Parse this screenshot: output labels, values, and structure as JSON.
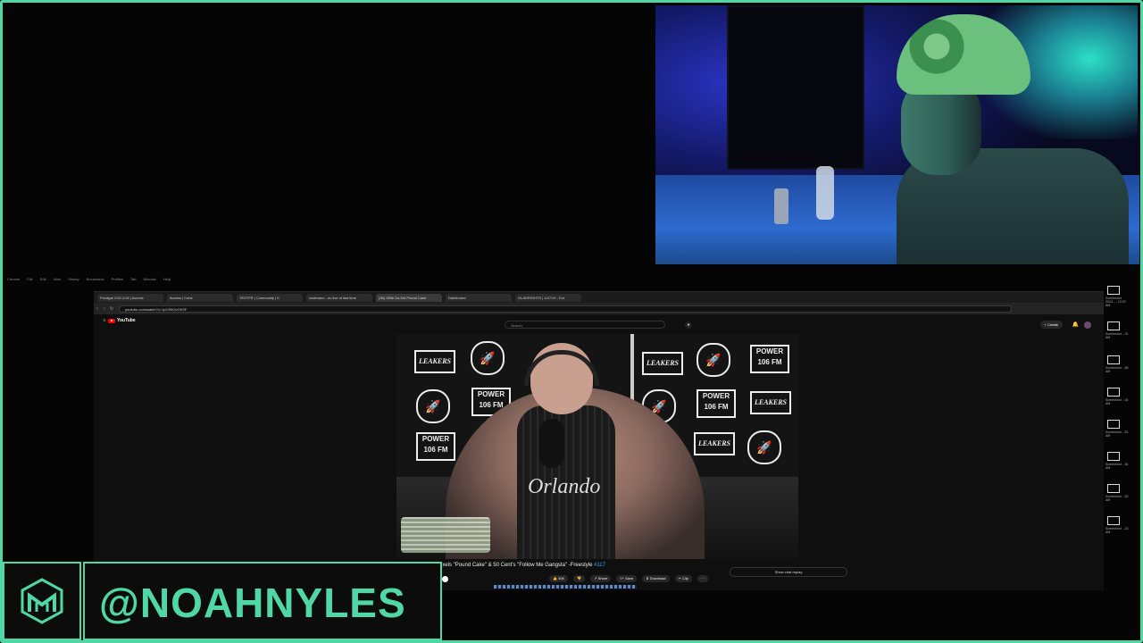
{
  "os_menu": [
    "Chrome",
    "File",
    "Edit",
    "View",
    "History",
    "Bookmarks",
    "Profiles",
    "Tab",
    "Window",
    "Help"
  ],
  "browser": {
    "tabs": [
      {
        "label": "Prodigal 1/10-1/16 | Access"
      },
      {
        "label": "Access | Cohe"
      },
      {
        "label": "TEXTFR | Community | K"
      },
      {
        "label": "codenano - av live of last time"
      },
      {
        "label": "(36) Gillie Da Kid Pound Cake"
      },
      {
        "label": "Dashboard"
      },
      {
        "label": "GLADRIGHTS | 12/7/19 - Ext"
      }
    ],
    "url": "youtube.com/watch?v=1pOS6OvOK3F",
    "youtube_logo": "YouTube",
    "search_placeholder": "Search",
    "create_label": "Create"
  },
  "video": {
    "backdrop_logos": [
      "LEAKERS",
      "POWER 106 FM"
    ],
    "jersey_text": "Orlando",
    "title_prefix": "ixels \"Pound Cake\" & 50 Cent's \"Follow Me Gangsta\" -Freestyle",
    "title_tag": "#117",
    "actions": [
      "👍 30K",
      "👎",
      "↗ Share",
      "≡+ Save",
      "⬇ Download",
      "✂ Clip",
      "···"
    ],
    "live_chat": "Show chat replay"
  },
  "right_panel": [
    "Screenshot 2024-..., 12:33 AM",
    "Screenshot ...01 AM",
    "Screenshot ...56 AM",
    "Screenshot ...04 AM",
    "Screenshot ...51 AM",
    "Screenshot ...54 AM",
    "Screenshot ...52 AM",
    "Screenshot ...23 AM"
  ],
  "banner": {
    "handle": "@NOAHNYLES"
  },
  "colors": {
    "accent": "#4fd8a6",
    "youtube_red": "#ff0000",
    "link_blue": "#3ea6ff"
  }
}
